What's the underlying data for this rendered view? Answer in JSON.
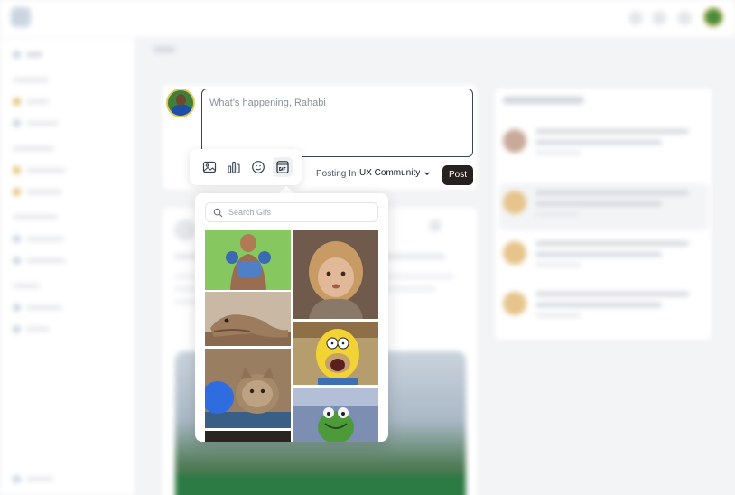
{
  "composer": {
    "placeholder": "What’s happening, Rahabi",
    "posting_label": "Posting In",
    "community": "UX Community",
    "post_label": "Post"
  },
  "toolbar": {
    "items": [
      {
        "icon": "image-icon"
      },
      {
        "icon": "poll-chart-icon"
      },
      {
        "icon": "emoji-icon"
      },
      {
        "icon": "gif-icon",
        "active": true
      }
    ]
  },
  "gif_picker": {
    "search_placeholder": "Search Gifs",
    "gifs": [
      {
        "icon": "gif-man-gloves"
      },
      {
        "icon": "gif-little-girl"
      },
      {
        "icon": "gif-lizard"
      },
      {
        "icon": "gif-homer-simpson"
      },
      {
        "icon": "gif-cat"
      },
      {
        "icon": "gif-kermit"
      },
      {
        "icon": "gif-dark"
      }
    ]
  },
  "colors": {
    "post_button": "#27211f",
    "textarea_border": "#3b4451"
  }
}
